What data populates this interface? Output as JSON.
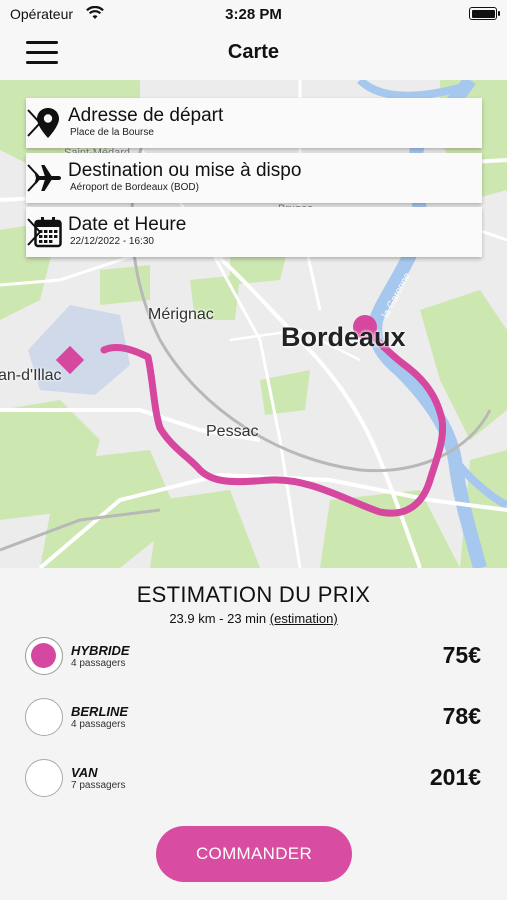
{
  "status": {
    "carrier": "Opérateur",
    "time": "3:28 PM"
  },
  "nav": {
    "title": "Carte"
  },
  "map": {
    "labels": {
      "merignac": "Mérignac",
      "pessac": "Pessac",
      "illac": "an-d'Illac",
      "bordeaux": "Bordeaux",
      "garonne": "la Garonne",
      "stmedard": "Saint-Médard",
      "bruges": "Bruges"
    },
    "route_color": "#d6479f"
  },
  "trip": {
    "departure": {
      "title": "Adresse de départ",
      "value": "Place de la Bourse"
    },
    "destination": {
      "title": "Destination ou mise à dispo",
      "value": "Aéroport de Bordeaux (BOD)"
    },
    "datetime": {
      "title": "Date et Heure",
      "value": "22/12/2022 - 16:30"
    }
  },
  "pricing": {
    "title": "ESTIMATION DU PRIX",
    "summary": "23.9 km - 23 min",
    "estimate_link": "(estimation)",
    "options": [
      {
        "name": "HYBRIDE",
        "capacity": "4 passagers",
        "price": "75€",
        "selected": true
      },
      {
        "name": "BERLINE",
        "capacity": "4 passagers",
        "price": "78€",
        "selected": false
      },
      {
        "name": "VAN",
        "capacity": "7 passagers",
        "price": "201€",
        "selected": false
      }
    ],
    "order_label": "COMMANDER"
  },
  "colors": {
    "accent": "#d84da1",
    "water": "#a7c8ee",
    "park": "#cde7b0"
  },
  "icons": [
    "wifi-icon",
    "battery-icon",
    "menu-icon",
    "location-pin-icon",
    "airplane-icon",
    "calendar-icon",
    "chevron-right-icon"
  ]
}
